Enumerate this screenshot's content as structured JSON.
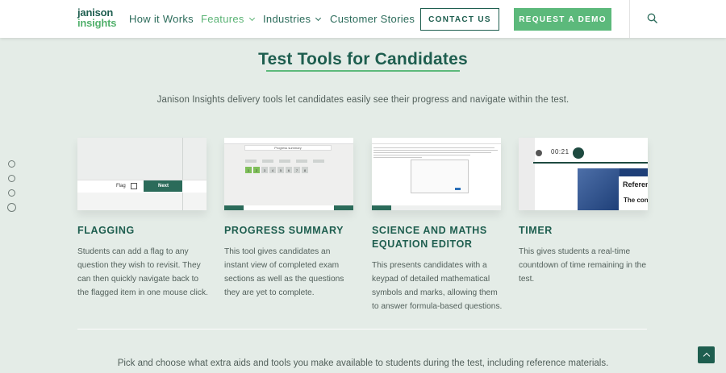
{
  "brand": {
    "line1": "janison",
    "line2": "insights"
  },
  "nav": {
    "items": [
      {
        "label": "How it Works",
        "dropdown": false,
        "active": false
      },
      {
        "label": "Features",
        "dropdown": true,
        "active": true
      },
      {
        "label": "Industries",
        "dropdown": true,
        "active": false
      },
      {
        "label": "Customer Stories",
        "dropdown": false,
        "active": false
      }
    ],
    "contact_label": "CONTACT US",
    "demo_label": "REQUEST A DEMO",
    "search_icon": "search-icon"
  },
  "section": {
    "title": "Test Tools for Candidates",
    "intro": "Janison Insights delivery tools let candidates easily see their progress and navigate within the test."
  },
  "features": [
    {
      "title": "FLAGGING",
      "text": "Students can add a flag to any question they wish to revisit. They can then quickly navigate back to the flagged item in one mouse click.",
      "thumb": {
        "flag_label": "Flag",
        "next_label": "Next"
      }
    },
    {
      "title": "PROGRESS SUMMARY",
      "text": "This tool gives candidates an instant view of completed exam sections as well as the questions they are yet to complete.",
      "thumb": {
        "box_label": "Progress summary",
        "numbers": [
          "1",
          "2",
          "3",
          "4",
          "5",
          "6",
          "7",
          "8"
        ],
        "done_count": 2
      }
    },
    {
      "title": "SCIENCE AND MATHS EQUATION EDITOR",
      "text": "This presents candidates with a keypad of detailed mathematical symbols and marks, allowing them to answer formula-based questions."
    },
    {
      "title": "TIMER",
      "text": "This gives students a real-time countdown of time remaining in the test.",
      "thumb": {
        "time": "00:21",
        "ref_text": "Referen",
        "con_text": "The con"
      }
    }
  ],
  "bottom_text": "Pick and choose what extra aids and tools you make available to students during the test, including reference materials.",
  "side_dots": [
    {
      "active": false
    },
    {
      "active": false
    },
    {
      "active": false
    },
    {
      "active": true
    }
  ],
  "colors": {
    "brand_dark": "#1e5e4f",
    "brand_green": "#5cb97b",
    "background": "#e4ece7"
  }
}
